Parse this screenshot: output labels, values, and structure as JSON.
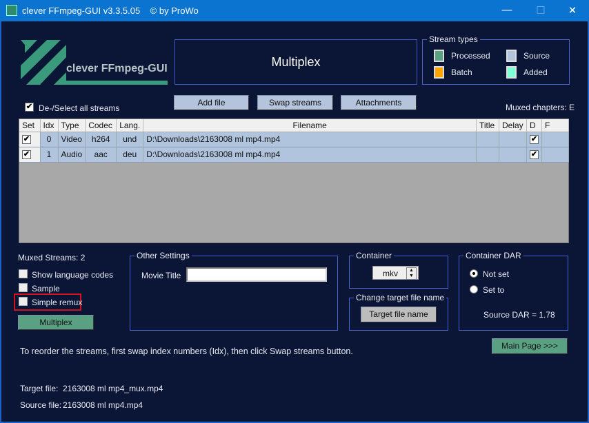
{
  "window": {
    "title": "clever FFmpeg-GUI v3.3.5.05    © by ProWo",
    "minimize": "—",
    "maximize": "☐",
    "close": "✕"
  },
  "logo": {
    "text": "clever FFmpeg-GUI"
  },
  "page_title": "Multiplex",
  "stream_types": {
    "label": "Stream types",
    "items": [
      {
        "label": "Processed",
        "color": "#5aa184"
      },
      {
        "label": "Source",
        "color": "#b4c4dc"
      },
      {
        "label": "Batch",
        "color": "#ffa500"
      },
      {
        "label": "Added",
        "color": "#7fffd4"
      }
    ]
  },
  "toolbar": {
    "add_file": "Add file",
    "swap_streams": "Swap streams",
    "attachments": "Attachments"
  },
  "select_all": {
    "label": "De-/Select all streams",
    "checked": true
  },
  "muxed_chapters": "Muxed chapters: E",
  "table": {
    "columns": [
      "Set",
      "Idx",
      "Type",
      "Codec",
      "Lang.",
      "Filename",
      "Title",
      "Delay",
      "D",
      "F"
    ],
    "rows": [
      {
        "set": true,
        "idx": "0",
        "type": "Video",
        "codec": "h264",
        "lang": "und",
        "filename": "D:\\Downloads\\2163008 ml mp4.mp4",
        "title": "",
        "delay": "",
        "d": true,
        "f": ""
      },
      {
        "set": true,
        "idx": "1",
        "type": "Audio",
        "codec": "aac",
        "lang": "deu",
        "filename": "D:\\Downloads\\2163008 ml mp4.mp4",
        "title": "",
        "delay": "",
        "d": true,
        "f": ""
      }
    ]
  },
  "muxed_streams": "Muxed Streams:  2",
  "options": {
    "show_language_codes": "Show language codes",
    "sample": "Sample",
    "simple_remux": "Simple remux"
  },
  "multiplex_button": "Multiplex",
  "other_settings": {
    "label": "Other Settings",
    "movie_title_label": "Movie Title",
    "movie_title_value": ""
  },
  "container": {
    "label": "Container",
    "value": "mkv"
  },
  "change_target": {
    "label": "Change target file name",
    "button": "Target file name"
  },
  "container_dar": {
    "label": "Container DAR",
    "not_set": "Not set",
    "set_to": "Set to",
    "source_dar": "Source DAR = 1.78"
  },
  "main_page_button": "Main Page >>>",
  "instruction": "To reorder the streams, first swap index numbers (Idx), then click Swap streams button.",
  "target_file": {
    "label": "Target file:",
    "value": "2163008 ml mp4_mux.mp4"
  },
  "source_file": {
    "label": "Source file:",
    "value": "2163008 ml mp4.mp4"
  }
}
